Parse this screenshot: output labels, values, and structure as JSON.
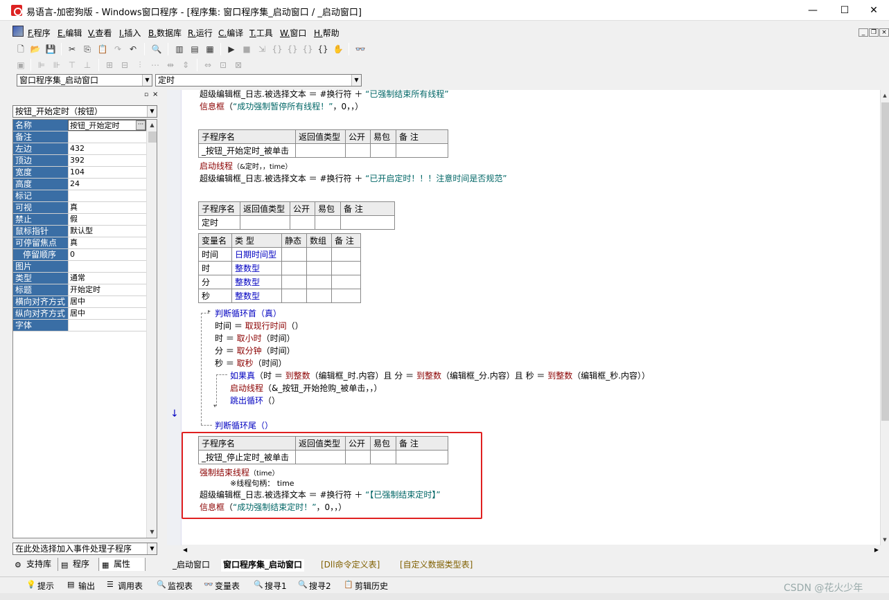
{
  "window": {
    "title": "易语言-加密狗版 - Windows窗口程序 - [程序集: 窗口程序集_启动窗口 / _启动窗口]",
    "minimize": "—",
    "maximize": "☐",
    "close": "✕"
  },
  "menu": [
    {
      "key": "F.",
      "label": "程序"
    },
    {
      "key": "E.",
      "label": "编辑"
    },
    {
      "key": "V.",
      "label": "查看"
    },
    {
      "key": "I.",
      "label": "插入"
    },
    {
      "key": "B.",
      "label": "数据库"
    },
    {
      "key": "R.",
      "label": "运行"
    },
    {
      "key": "C.",
      "label": "编译"
    },
    {
      "key": "T.",
      "label": "工具"
    },
    {
      "key": "W.",
      "label": "窗口"
    },
    {
      "key": "H.",
      "label": "帮助"
    }
  ],
  "selectors": {
    "assembly": "窗口程序集_启动窗口",
    "subroutine": "定时"
  },
  "left_panel": {
    "component": "按钮_开始定时（按钮）",
    "properties": [
      {
        "name": "名称",
        "value": "按钮_开始定时"
      },
      {
        "name": "备注",
        "value": ""
      },
      {
        "name": "左边",
        "value": "432"
      },
      {
        "name": "顶边",
        "value": "392"
      },
      {
        "name": "宽度",
        "value": "104"
      },
      {
        "name": "高度",
        "value": "24"
      },
      {
        "name": "标记",
        "value": ""
      },
      {
        "name": "可视",
        "value": "真"
      },
      {
        "name": "禁止",
        "value": "假"
      },
      {
        "name": "鼠标指针",
        "value": "默认型"
      },
      {
        "name": "可停留焦点",
        "value": "真"
      },
      {
        "name": "停留顺序",
        "value": "0"
      },
      {
        "name": "图片",
        "value": ""
      },
      {
        "name": "类型",
        "value": "通常"
      },
      {
        "name": "标题",
        "value": "开始定时"
      },
      {
        "name": "横向对齐方式",
        "value": "居中"
      },
      {
        "name": "纵向对齐方式",
        "value": "居中"
      },
      {
        "name": "字体",
        "value": ""
      }
    ],
    "event_combo": "在此处选择加入事件处理子程序",
    "tabs": [
      "支持库",
      "程序",
      "属性"
    ]
  },
  "code": {
    "line1": {
      "a": "超级编辑框_日志.被选择文本 ＝ #换行符 ＋ ",
      "b": "“已强制结束所有线程”"
    },
    "line2": {
      "a": "信息框",
      "b": "（",
      "c": "“成功强制暂停所有线程！”",
      "d": "，0，，）"
    },
    "sub_header": [
      "子程序名",
      "返回值类型",
      "公开",
      "易包",
      "备 注"
    ],
    "sub1_name": "_按钮_开始定时_被单击",
    "sub1_l1": {
      "a": "启动线程",
      "b": "（&定时，，time）"
    },
    "sub1_l2": {
      "a": "超级编辑框_日志.被选择文本 ＝ #换行符 ＋ ",
      "b": "“已开启定时！！！注意时间是否规范”"
    },
    "sub2_name": "定时",
    "var_header": [
      "变量名",
      "类 型",
      "静态",
      "数组",
      "备 注"
    ],
    "vars": [
      {
        "name": "时间",
        "type": "日期时间型"
      },
      {
        "name": "时",
        "type": "整数型"
      },
      {
        "name": "分",
        "type": "整数型"
      },
      {
        "name": "秒",
        "type": "整数型"
      }
    ],
    "loop_head": "判断循环首（真）",
    "loop_lines": [
      {
        "a": "时间 ＝ ",
        "b": "取现行时间",
        "c": "（）"
      },
      {
        "a": "时 ＝ ",
        "b": "取小时",
        "c": "（时间）"
      },
      {
        "a": "分 ＝ ",
        "b": "取分钟",
        "c": "（时间）"
      },
      {
        "a": "秒 ＝ ",
        "b": "取秒",
        "c": "（时间）"
      }
    ],
    "if_line": {
      "a": "如果真",
      "b": "（时 ＝ ",
      "c": "到整数",
      "d": "（编辑框_时.内容）且 分 ＝ ",
      "e": "到整数",
      "f": "（编辑框_分.内容）且 秒 ＝ ",
      "g": "到整数",
      "h": "（编辑框_秒.内容））"
    },
    "if_body1": {
      "a": "启动线程",
      "b": "（&_按钮_开始抢购_被单击，，）"
    },
    "if_body2": {
      "a": "跳出循环",
      "b": "（）"
    },
    "loop_tail": "判断循环尾（）",
    "sub3_name": "_按钮_停止定时_被单击",
    "sub3_l1": {
      "a": "强制结束线程",
      "b": "（time）"
    },
    "sub3_hint": "※线程句柄： time",
    "sub3_l2": {
      "a": "超级编辑框_日志.被选择文本 ＝ #换行符 ＋ ",
      "b": "“【已强制结束定时】”"
    },
    "sub3_l3": {
      "a": "信息框",
      "b": "（",
      "c": "“成功强制结束定时！”",
      "d": "，0，，）"
    }
  },
  "editor_tabs": [
    "_启动窗口",
    "窗口程序集_启动窗口",
    "[Dll命令定义表]",
    "[自定义数据类型表]"
  ],
  "output_tabs": [
    "提示",
    "输出",
    "调用表",
    "监视表",
    "变量表",
    "搜寻1",
    "搜寻2",
    "剪辑历史"
  ],
  "watermark": "CSDN @花火少年"
}
